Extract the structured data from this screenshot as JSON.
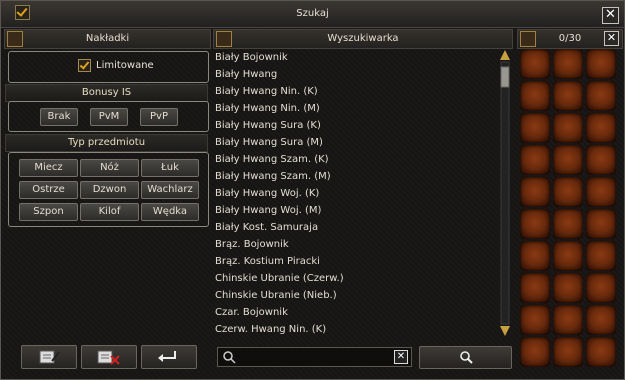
{
  "window": {
    "title": "Szukaj"
  },
  "tabs_panel": {
    "title": "Nakładki",
    "limited_label": "Limitowane",
    "limited_checked": true
  },
  "bonus_section": {
    "title": "Bonusy IS",
    "buttons": [
      "Brak",
      "PvM",
      "PvP"
    ]
  },
  "type_section": {
    "title": "Typ przedmiotu",
    "buttons": [
      "Miecz",
      "Nóż",
      "Łuk",
      "Ostrze",
      "Dzwon",
      "Wachlarz",
      "Szpon",
      "Kilof",
      "Wędka"
    ]
  },
  "search_panel": {
    "title": "Wyszukiwarka",
    "items": [
      "Biały Bojownik",
      "Biały Hwang",
      "Biały Hwang Nin. (K)",
      "Biały Hwang Nin. (M)",
      "Biały Hwang Sura (K)",
      "Biały Hwang Sura (M)",
      "Biały Hwang Szam. (K)",
      "Biały Hwang Szam. (M)",
      "Biały Hwang Woj. (K)",
      "Biały Hwang Woj. (M)",
      "Biały Kost. Samuraja",
      "Brąz. Bojownik",
      "Brąz. Kostium Piracki",
      "Chinskie Ubranie (Czerw.)",
      "Chinskie Ubranie (Nieb.)",
      "Czar. Bojownik",
      "Czerw. Hwang Nin. (K)"
    ],
    "search_value": "",
    "search_placeholder": ""
  },
  "inventory": {
    "counter": "0/30",
    "slots": 30
  },
  "icons": {
    "close": "close-icon",
    "search": "search-icon",
    "clear": "clear-icon"
  }
}
